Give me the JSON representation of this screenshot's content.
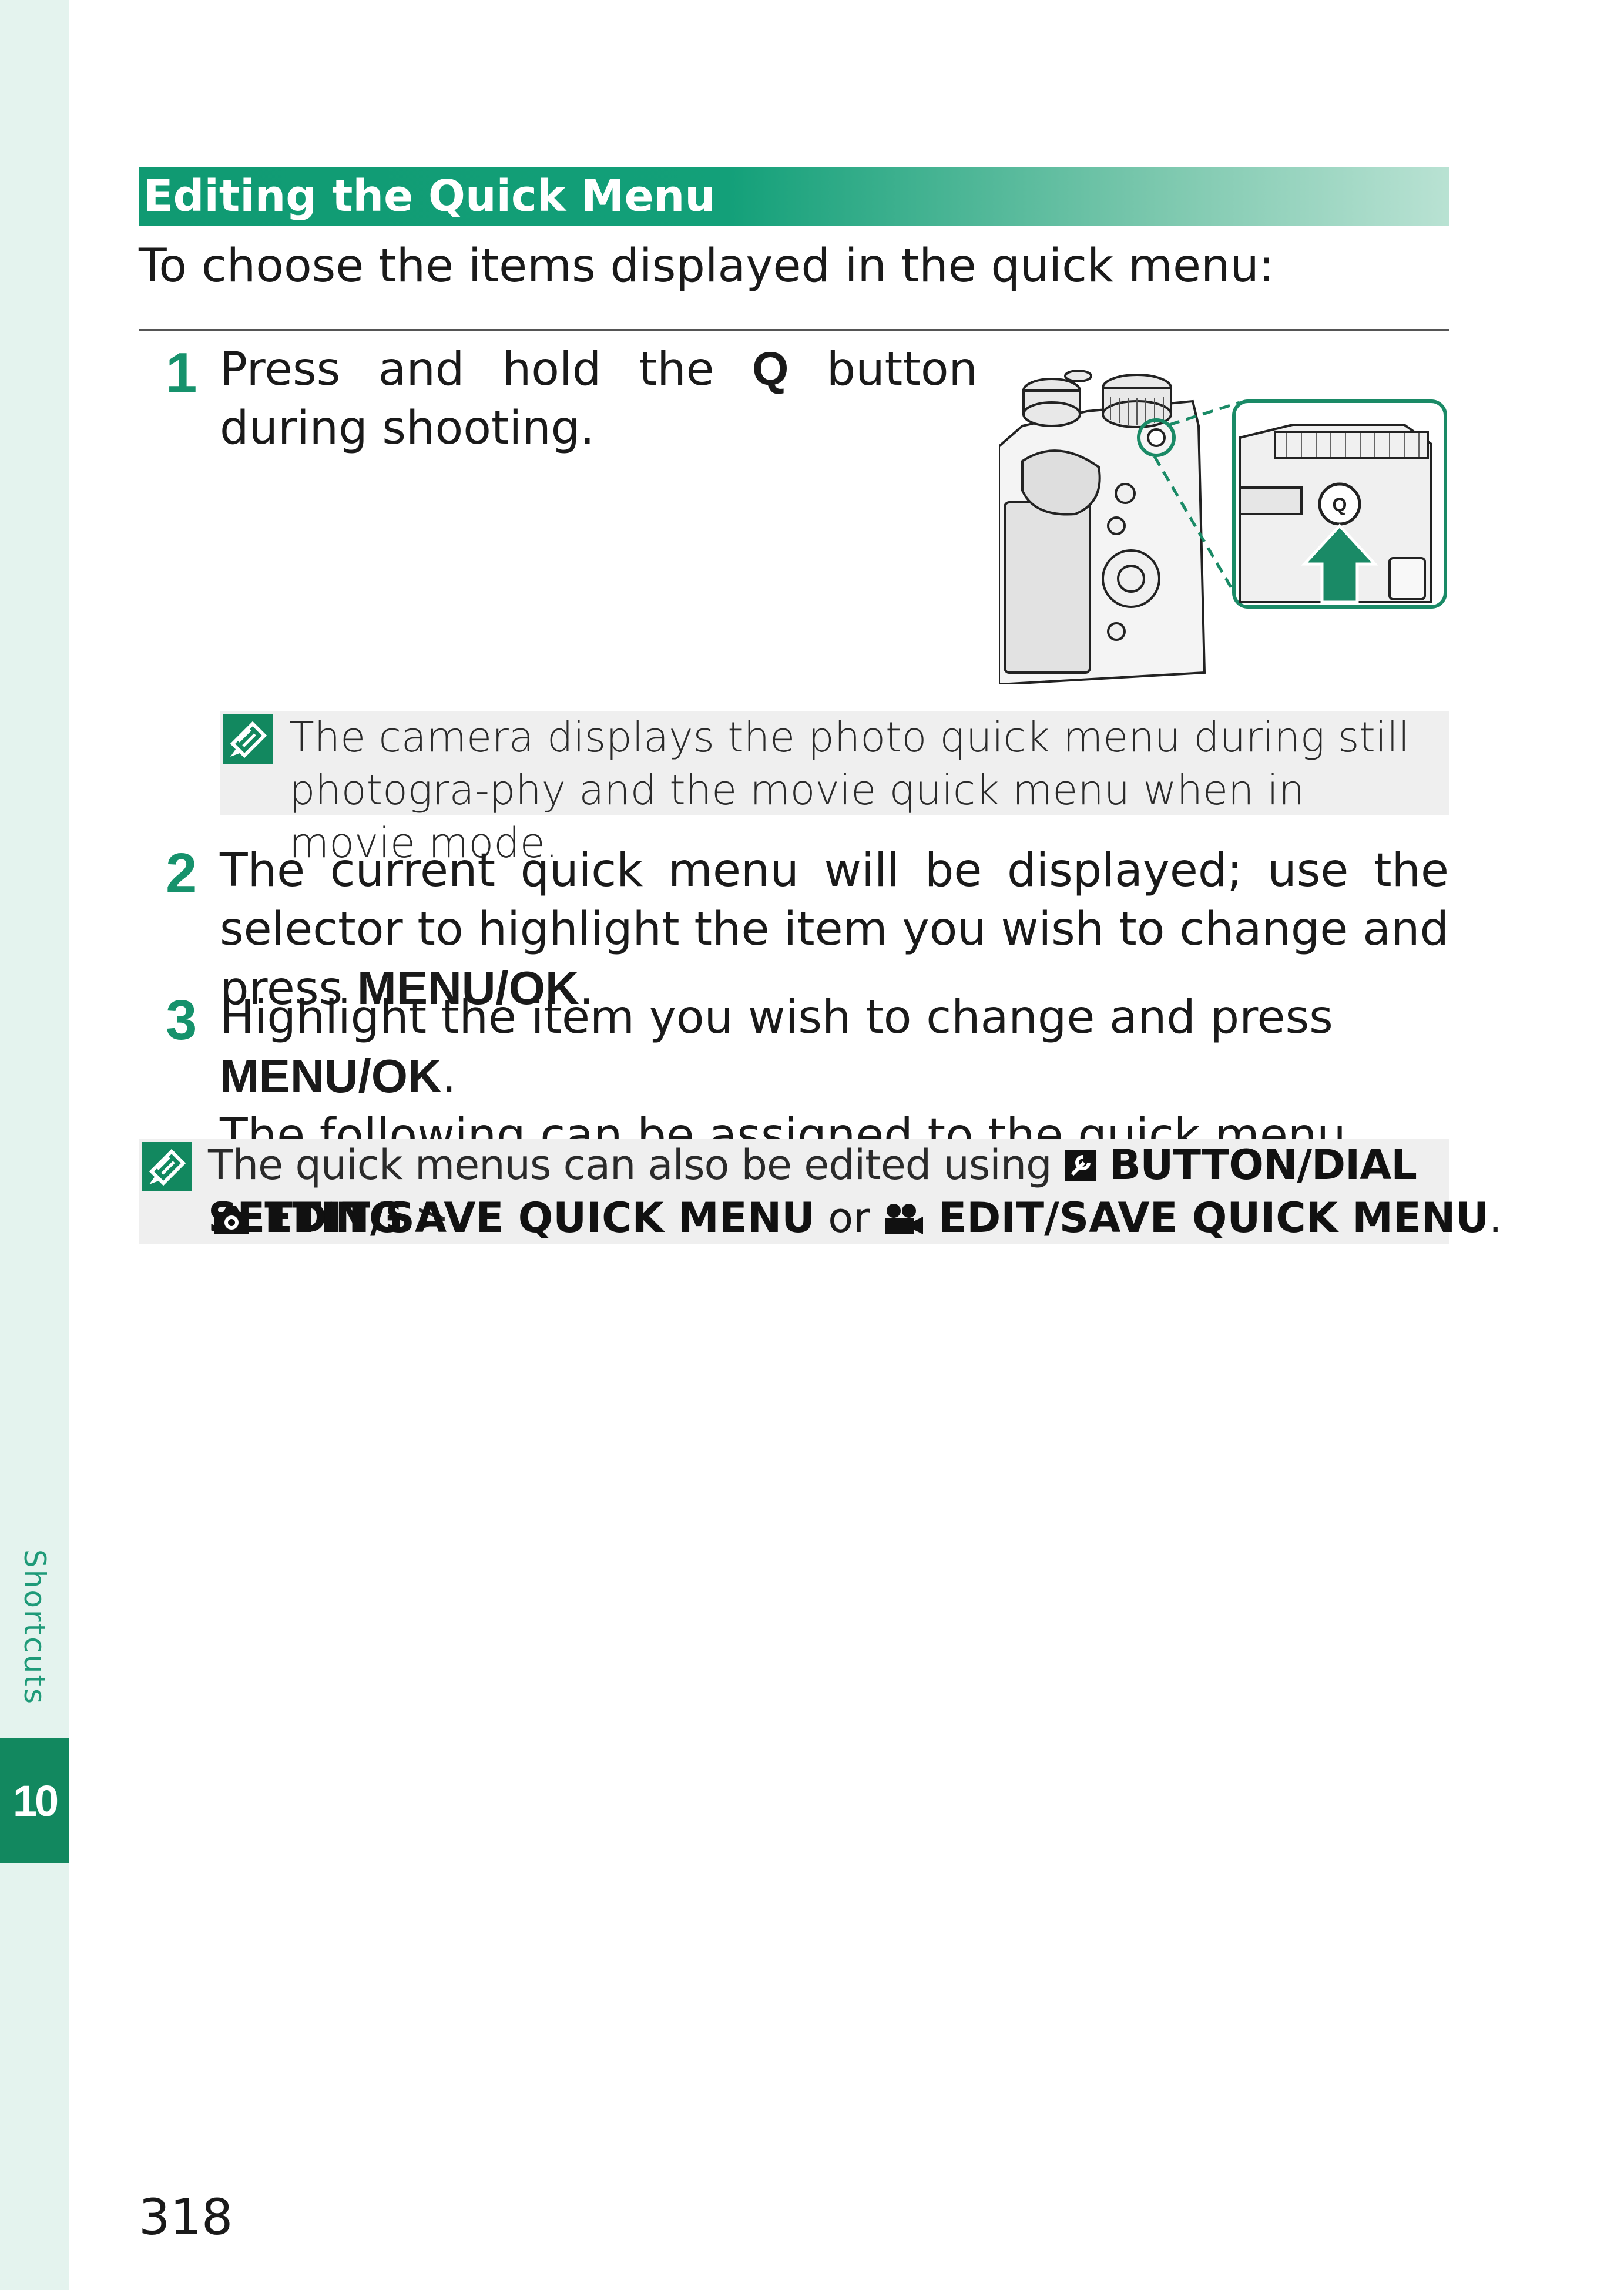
{
  "sidebar": {
    "section_label": "Shortcuts",
    "chapter_number": "10"
  },
  "heading": "Editing the Quick Menu",
  "intro": "To choose the items displayed in the quick menu:",
  "steps": [
    {
      "number": "1",
      "text_before": "Press and hold the ",
      "key": "Q",
      "text_after": " button during shooting."
    },
    {
      "number": "2",
      "text_before": "The current quick menu will be displayed; use the selector to highlight the item you wish to change and press ",
      "key": "MENU/OK",
      "text_after": "."
    },
    {
      "number": "3",
      "text_before": "Highlight the item you wish to change and press ",
      "key": "MENU/OK",
      "text_after": ".",
      "text_line2": "The following can be assigned to the quick menu."
    }
  ],
  "illustration": {
    "button_label": "Q",
    "accent_color": "#1a8a66"
  },
  "notes": [
    {
      "text": "The camera displays the photo quick menu during still photogra-phy and the movie quick menu when in movie mode."
    },
    {
      "prefix": "The quick menus can also be edited using ",
      "menu": "BUTTON/DIAL SETTING",
      "separator": " >",
      "item_still": "EDIT/SAVE QUICK MENU",
      "or": " or ",
      "item_movie": "EDIT/SAVE QUICK MENU",
      "suffix": "."
    }
  ],
  "page_number": "318",
  "colors": {
    "accent": "#12885f",
    "rail": "#e4f3ee",
    "note_bg": "#efefef"
  }
}
